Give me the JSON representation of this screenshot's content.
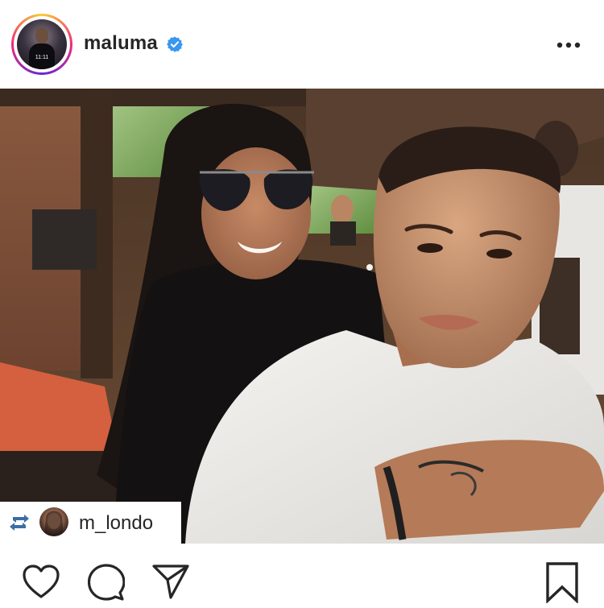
{
  "post": {
    "username": "maluma",
    "verified": true,
    "avatar_text": "11:11",
    "repost_from": "m_londo"
  },
  "icons": {
    "verified": "verified-badge-icon",
    "more": "more-options-icon",
    "repost": "repost-icon",
    "like": "heart-icon",
    "comment": "comment-icon",
    "share": "share-icon",
    "save": "bookmark-icon"
  },
  "colors": {
    "text": "#262626",
    "verified": "#3897f0"
  }
}
